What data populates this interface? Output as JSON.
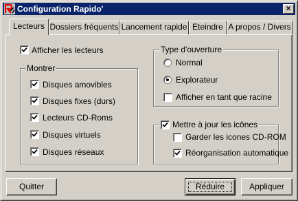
{
  "window": {
    "title": "Configuration Rapido'",
    "close_label": "×"
  },
  "tabs": [
    {
      "label": "Lecteurs",
      "active": true
    },
    {
      "label": "Dossiers fréquents",
      "active": false
    },
    {
      "label": "Lancement rapide",
      "active": false
    },
    {
      "label": "Eteindre",
      "active": false
    },
    {
      "label": "A propos / Divers",
      "active": false
    }
  ],
  "lecteurs": {
    "show_drives": {
      "label": "Afficher les lecteurs",
      "checked": true
    },
    "montrer": {
      "title": "Montrer",
      "items": [
        {
          "label": "Disques amovibles",
          "checked": true
        },
        {
          "label": "Disques fixes (durs)",
          "checked": true
        },
        {
          "label": "Lecteurs CD-Roms",
          "checked": true
        },
        {
          "label": "Disques virtuels",
          "checked": true
        },
        {
          "label": "Disques réseaux",
          "checked": true
        }
      ]
    },
    "ouverture": {
      "title": "Type d'ouverture",
      "normal": "Normal",
      "explorateur": "Explorateur",
      "selected": "Explorateur",
      "racine": {
        "label": "Afficher en tant que racine",
        "checked": false
      }
    },
    "icones": {
      "title": {
        "label": "Mettre à jour les icônes",
        "checked": true
      },
      "garder": {
        "label": "Garder les icones CD-ROM",
        "checked": false
      },
      "reorg": {
        "label": "Réorganisation automatique",
        "checked": true
      }
    }
  },
  "buttons": {
    "quit": "Quitter",
    "reduce": "Réduire",
    "apply": "Appliquer"
  }
}
